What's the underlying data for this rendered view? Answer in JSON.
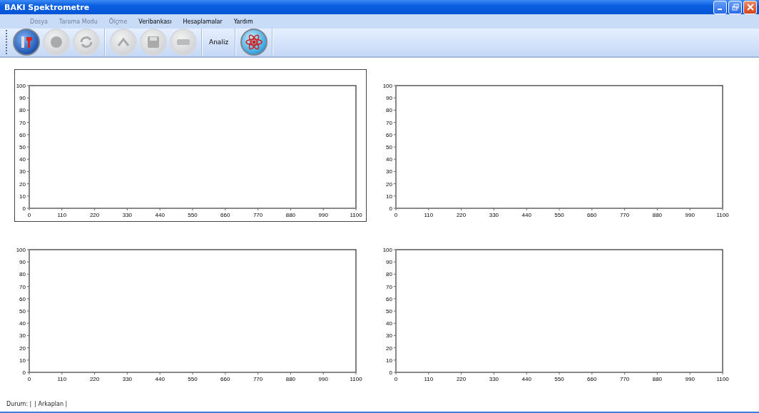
{
  "window": {
    "title": "BAKI Spektrometre"
  },
  "menu": [
    {
      "label": "Dosya",
      "disabled": true
    },
    {
      "label": "Tarama Modu",
      "disabled": true
    },
    {
      "label": "Ölçme",
      "disabled": true
    },
    {
      "label": "Veribankası",
      "disabled": false
    },
    {
      "label": "Hesaplamalar",
      "disabled": false
    },
    {
      "label": "Yardım",
      "disabled": false
    }
  ],
  "toolbar": [
    {
      "kind": "icon",
      "disabled": false
    },
    {
      "kind": "icon",
      "disabled": true
    },
    {
      "kind": "icon",
      "disabled": true
    },
    {
      "kind": "separator"
    },
    {
      "kind": "icon",
      "disabled": true
    },
    {
      "kind": "icon",
      "disabled": true
    },
    {
      "kind": "icon",
      "disabled": true
    },
    {
      "kind": "separator"
    },
    {
      "kind": "label",
      "label": "Analiz"
    },
    {
      "kind": "separator"
    },
    {
      "kind": "icon",
      "disabled": false
    },
    {
      "kind": "separator"
    }
  ],
  "charts": [
    {
      "selected": true,
      "chart_data": {
        "type": "line",
        "xlim": [
          0,
          1100
        ],
        "ylim": [
          0,
          100
        ],
        "xticks": [
          0,
          110,
          220,
          330,
          440,
          550,
          660,
          770,
          880,
          990,
          1100
        ],
        "yticks": [
          0,
          10,
          20,
          30,
          40,
          50,
          60,
          70,
          80,
          90,
          100
        ]
      }
    },
    {
      "selected": false,
      "chart_data": {
        "type": "line",
        "xlim": [
          0,
          1100
        ],
        "ylim": [
          0,
          100
        ],
        "xticks": [
          0,
          110,
          220,
          330,
          440,
          550,
          660,
          770,
          880,
          990,
          1100
        ],
        "yticks": [
          0,
          10,
          20,
          30,
          40,
          50,
          60,
          70,
          80,
          90,
          100
        ]
      }
    },
    {
      "selected": false,
      "chart_data": {
        "type": "line",
        "xlim": [
          0,
          1100
        ],
        "ylim": [
          0,
          100
        ],
        "xticks": [
          0,
          110,
          220,
          330,
          440,
          550,
          660,
          770,
          880,
          990,
          1100
        ],
        "yticks": [
          0,
          10,
          20,
          30,
          40,
          50,
          60,
          70,
          80,
          90,
          100
        ]
      }
    },
    {
      "selected": false,
      "chart_data": {
        "type": "line",
        "xlim": [
          0,
          1100
        ],
        "ylim": [
          0,
          100
        ],
        "xticks": [
          0,
          110,
          220,
          330,
          440,
          550,
          660,
          770,
          880,
          990,
          1100
        ],
        "yticks": [
          0,
          10,
          20,
          30,
          40,
          50,
          60,
          70,
          80,
          90,
          100
        ]
      }
    }
  ],
  "status_bar": [
    "Durum: |",
    "| Arkaplan |"
  ]
}
